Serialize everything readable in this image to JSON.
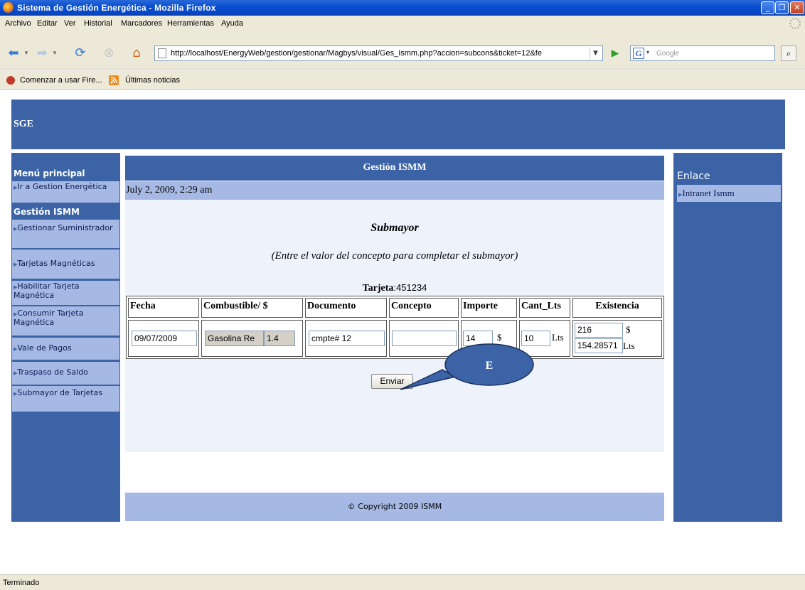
{
  "window": {
    "title": "Sistema de Gestión Energética - Mozilla Firefox"
  },
  "menubar": {
    "items": [
      "Archivo",
      "Editar",
      "Ver",
      "Historial",
      "Marcadores",
      "Herramientas",
      "Ayuda"
    ]
  },
  "navbar": {
    "url": "http://localhost/EnergyWeb/gestion/gestionar/Magbys/visual/Ges_Ismm.php?accion=subcons&ticket=12&fe",
    "search_placeholder": "Google"
  },
  "bookmarks": {
    "items": [
      "Comenzar a usar Fire...",
      "Últimas noticias"
    ]
  },
  "page": {
    "banner": "SGE",
    "left_nav": {
      "menu_title": "Menú principal",
      "section_title": "Gestión ISMM",
      "items": [
        "Ir a Gestion Energética",
        "Gestionar Suministrador",
        "Tarjetas Magnéticas",
        "Habilitar Tarjeta Magnética",
        "Consumir Tarjeta Magnética",
        "Vale de Pagos",
        "Traspaso de Saldo",
        "Submayor de Tarjetas"
      ]
    },
    "main": {
      "header": "Gestión ISMM",
      "date": "July 2, 2009, 2:29 am",
      "subtitle": "Submayor",
      "instruction": "(Entre el valor del concepto para completar el submayor)",
      "tarjeta_label": "Tarjeta",
      "tarjeta_value": ":451234",
      "table": {
        "headers": [
          "Fecha",
          "Combustible/ $",
          "Documento",
          "Concepto",
          "Importe",
          "Cant_Lts",
          "Existencia"
        ],
        "row": {
          "fecha": "09/07/2009",
          "combustible": "Gasolina Re",
          "precio": "1.4",
          "documento": "cmpte# 12",
          "concepto": "",
          "importe": "14",
          "importe_unit": "$",
          "cant_lts": "10",
          "cant_lts_unit": "Lts",
          "existencia_importe": "216",
          "existencia_importe_unit": "$",
          "existencia_lts": "154.28571",
          "existencia_lts_unit": "Lts"
        }
      },
      "submit_label": "Enviar"
    },
    "footer": "© Copyright 2009 ISMM",
    "right_nav": {
      "title": "Enlace",
      "items": [
        "Intranet Ismm"
      ]
    },
    "callout_label": "E"
  },
  "status": "Terminado",
  "colors": {
    "nav_blue": "#3c63a6",
    "light_blue": "#a6b8e4",
    "panel_bg": "#eef3fb"
  }
}
